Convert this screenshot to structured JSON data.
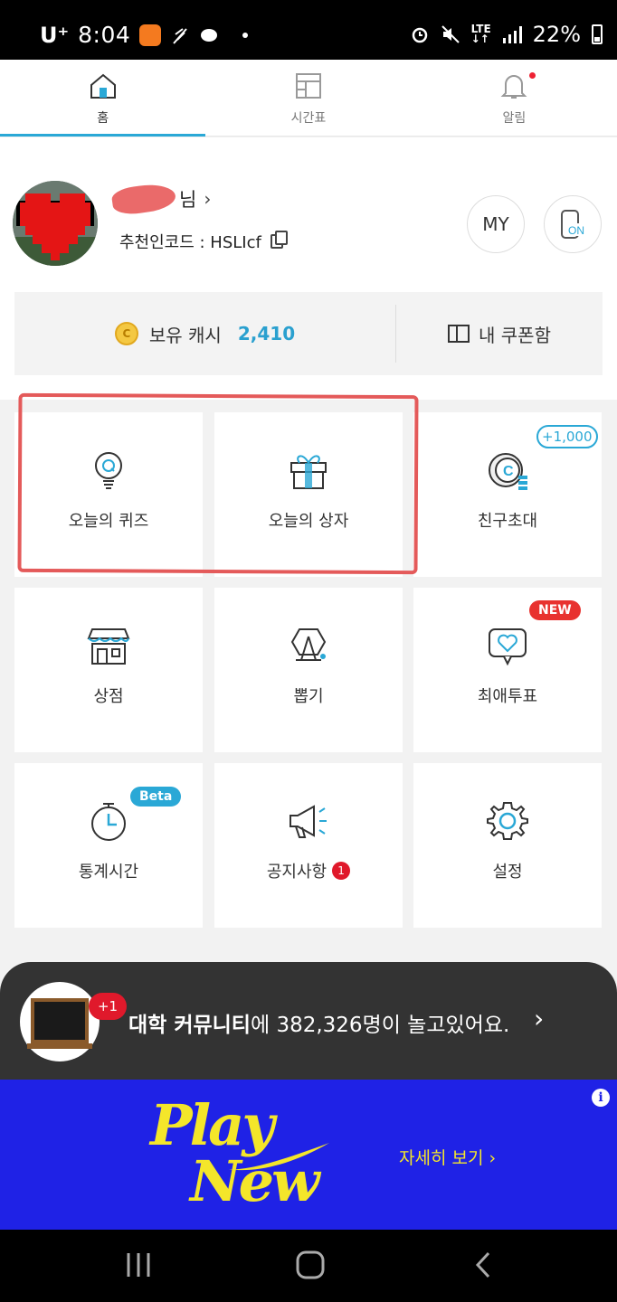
{
  "status_bar": {
    "carrier": "U⁺",
    "time": "8:04",
    "battery": "22%"
  },
  "tabs": [
    {
      "label": "홈",
      "icon": "home-icon",
      "active": true
    },
    {
      "label": "시간표",
      "icon": "timetable-icon",
      "active": false
    },
    {
      "label": "알림",
      "icon": "bell-icon",
      "active": false
    }
  ],
  "profile": {
    "name_suffix": "님",
    "referral_label": "추천인코드 : HSLIcf",
    "my_button": "MY",
    "on_button": "ON"
  },
  "cash": {
    "label": "보유 캐시",
    "value": "2,410",
    "coin_letter": "C",
    "coupon_label": "내 쿠폰함"
  },
  "menu": [
    {
      "label": "오늘의 퀴즈",
      "icon": "quiz-bulb-icon"
    },
    {
      "label": "오늘의 상자",
      "icon": "gift-box-icon"
    },
    {
      "label": "친구초대",
      "icon": "coin-stack-icon",
      "badge": "+1,000"
    },
    {
      "label": "상점",
      "icon": "store-icon"
    },
    {
      "label": "뽑기",
      "icon": "claw-machine-icon"
    },
    {
      "label": "최애투표",
      "icon": "heart-chat-icon",
      "badge": "NEW"
    },
    {
      "label": "통계시간",
      "icon": "stopwatch-icon",
      "badge": "Beta"
    },
    {
      "label": "공지사항",
      "icon": "megaphone-icon",
      "count": "1"
    },
    {
      "label": "설정",
      "icon": "gear-icon"
    }
  ],
  "community": {
    "badge": "+1",
    "bold": "대학 커뮤니티",
    "text": "에 382,326명이 놀고있어요."
  },
  "ad": {
    "logo_line1": "Play",
    "logo_line2": "New",
    "cta": "자세히 보기 ›",
    "info": "i"
  },
  "colors": {
    "accent": "#2aa8d6",
    "red": "#e8322f",
    "ad_bg": "#1f22e6",
    "ad_text": "#f4e62a"
  }
}
